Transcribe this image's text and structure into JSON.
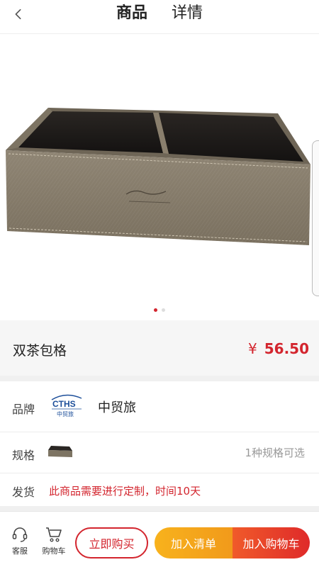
{
  "header": {
    "back_icon": "chevron-left-icon",
    "tabs": [
      {
        "label": "商品",
        "active": true
      },
      {
        "label": "详情",
        "active": false
      }
    ]
  },
  "gallery": {
    "product_image": "tea-caddy-box-image",
    "dots": {
      "count": 2,
      "active_index": 0
    }
  },
  "product": {
    "title": "双茶包格",
    "price_symbol": "¥",
    "price_value": "56.50"
  },
  "info": {
    "brand": {
      "label": "品牌",
      "logo_text": "CTHS",
      "logo_subtext": "中贸旅",
      "name": "中贸旅"
    },
    "spec": {
      "label": "规格",
      "note": "1种规格可选"
    },
    "shipping": {
      "label": "发货",
      "note": "此商品需要进行定制，时间10天"
    }
  },
  "bottom_bar": {
    "service": {
      "label": "客服",
      "icon": "headset-icon"
    },
    "cart": {
      "label": "购物车",
      "icon": "cart-icon"
    },
    "buy_now": "立即购买",
    "add_to_list": "加入清单",
    "add_to_cart": "加入购物车"
  },
  "colors": {
    "accent": "#d3252e",
    "orange": "#f5a81c"
  }
}
